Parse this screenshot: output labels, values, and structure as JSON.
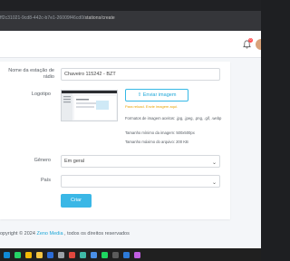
{
  "browser": {
    "url_host_part": "ff2c31021-9cd8-442c-b7e1-26009f46cd0/",
    "url_path_part": "stations/create"
  },
  "header": {
    "notification_count": "0"
  },
  "form": {
    "station_name_label": "Nome da estação de rádio",
    "station_name_value": "Chaveiro 115242 - BZT",
    "logo_label": "Logotipo",
    "upload_button_label": "Enviar imagem",
    "required_note": "Para reload. Envie imagem aqui.",
    "format_info": "Formatos de imagem aceitos: .jpg, .jpeg, .png, .gif, .webp",
    "min_size_info": "Tamanho mínimo da imagem: 500x500px",
    "max_file_info": "Tamanho máximo do arquivo: 200 KB",
    "genre_label": "Gênero",
    "genre_value": "Em geral",
    "country_label": "País",
    "country_value": "",
    "submit_label": "Criar"
  },
  "footer": {
    "prefix": "opyright © 2024 ",
    "link": "Zeno Media",
    "suffix": " , todos os direitos reservados"
  },
  "taskbar": {
    "icons": [
      "edge-icon",
      "whatsapp-icon",
      "chrome-icon",
      "files-icon",
      "store-icon",
      "settings-icon",
      "app-icon",
      "app2-icon",
      "mail-icon",
      "spotify-icon",
      "terminal-icon",
      "code-icon",
      "app3-icon"
    ],
    "colors": [
      "#0f8ad6",
      "#25d366",
      "#f2b706",
      "#f5c542",
      "#2b6cd6",
      "#9aa0a6",
      "#e0483e",
      "#3fb9a7",
      "#4a8fe7",
      "#1ed760",
      "#5b5b5b",
      "#2d7ad8",
      "#c05ee0"
    ]
  },
  "colors": {
    "accent": "#3ab7e6",
    "warning": "#e8a200",
    "badge": "#ff4d4f"
  }
}
